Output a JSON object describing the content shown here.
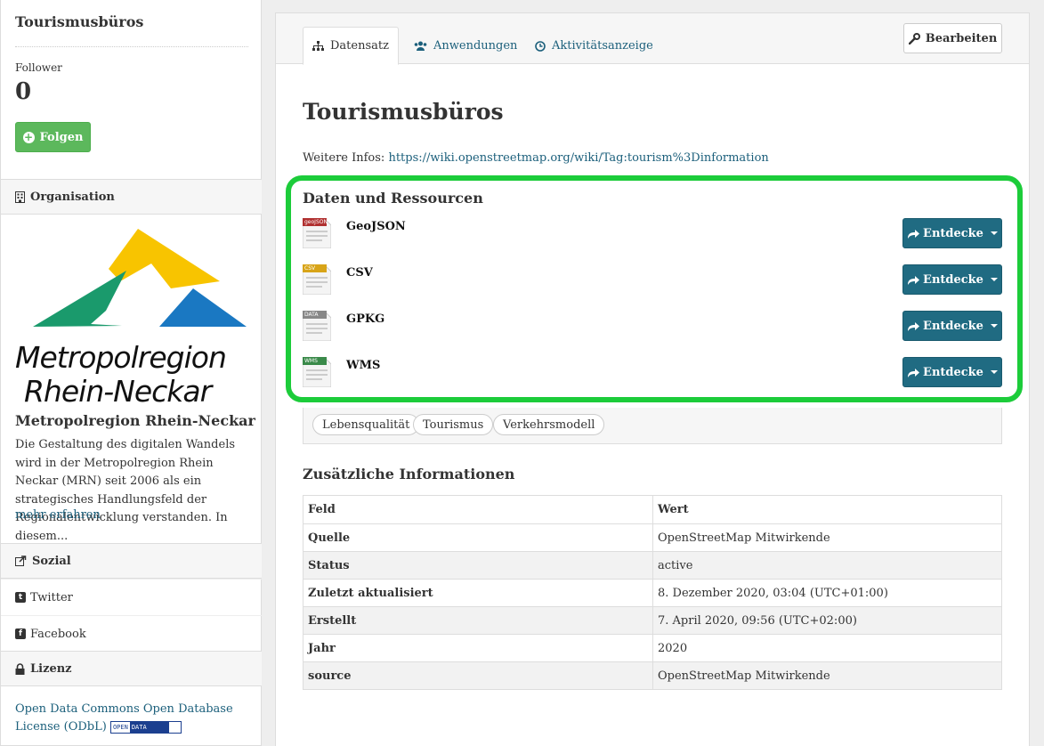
{
  "sidebar": {
    "title": "Tourismusbüros",
    "follower_label": "Follower",
    "follower_count": "0",
    "follow_button": "Folgen",
    "organisation_heading": "Organisation",
    "org_logo_line1": "Metropolregion",
    "org_logo_line2": "Rhein-Neckar",
    "org_name": "Metropolregion Rhein-Neckar",
    "org_description": "Die Gestaltung des digitalen Wandels wird in der Metropolregion Rhein Neckar (MRN) seit 2006 als ein strategisches Handlungsfeld der Regionalentwicklung verstanden. In diesem...",
    "org_more": "mehr erfahren",
    "social_heading": "Sozial",
    "twitter": "Twitter",
    "facebook": "Facebook",
    "license_heading": "Lizenz",
    "license_text": "Open Data Commons Open Database License (ODbL)",
    "badge_open": "OPEN",
    "badge_data": "DATA"
  },
  "tabs": {
    "dataset": "Datensatz",
    "apps": "Anwendungen",
    "activity": "Aktivitätsanzeige",
    "edit": "Bearbeiten"
  },
  "dataset": {
    "title": "Tourismusbüros",
    "info_label": "Weitere Infos:",
    "info_url": "https://wiki.openstreetmap.org/wiki/Tag:tourism%3Dinformation"
  },
  "resources": {
    "heading": "Daten und Ressourcen",
    "explore_label": "Entdecke",
    "items": [
      {
        "name": "GeoJSON",
        "icon_label": "geoJSON",
        "icon_color": "#b03030"
      },
      {
        "name": "CSV",
        "icon_label": "CSV",
        "icon_color": "#d8a418"
      },
      {
        "name": "GPKG",
        "icon_label": "DATA",
        "icon_color": "#888888"
      },
      {
        "name": "WMS",
        "icon_label": "WMS",
        "icon_color": "#3a8a4a"
      }
    ]
  },
  "tags": [
    "Lebensqualität",
    "Tourismus",
    "Verkehrsmodell"
  ],
  "additional": {
    "heading": "Zusätzliche Informationen",
    "col_field": "Feld",
    "col_value": "Wert",
    "rows": [
      {
        "k": "Quelle",
        "v": "OpenStreetMap Mitwirkende"
      },
      {
        "k": "Status",
        "v": "active"
      },
      {
        "k": "Zuletzt aktualisiert",
        "v": "8. Dezember 2020, 03:04 (UTC+01:00)"
      },
      {
        "k": "Erstellt",
        "v": "7. April 2020, 09:56 (UTC+02:00)"
      },
      {
        "k": "Jahr",
        "v": "2020"
      },
      {
        "k": "source",
        "v": "OpenStreetMap Mitwirkende"
      }
    ]
  },
  "colors": {
    "accent": "#206b82",
    "follow": "#5cb85c",
    "highlight": "#1ccc3a",
    "link": "#1b5f7b"
  }
}
